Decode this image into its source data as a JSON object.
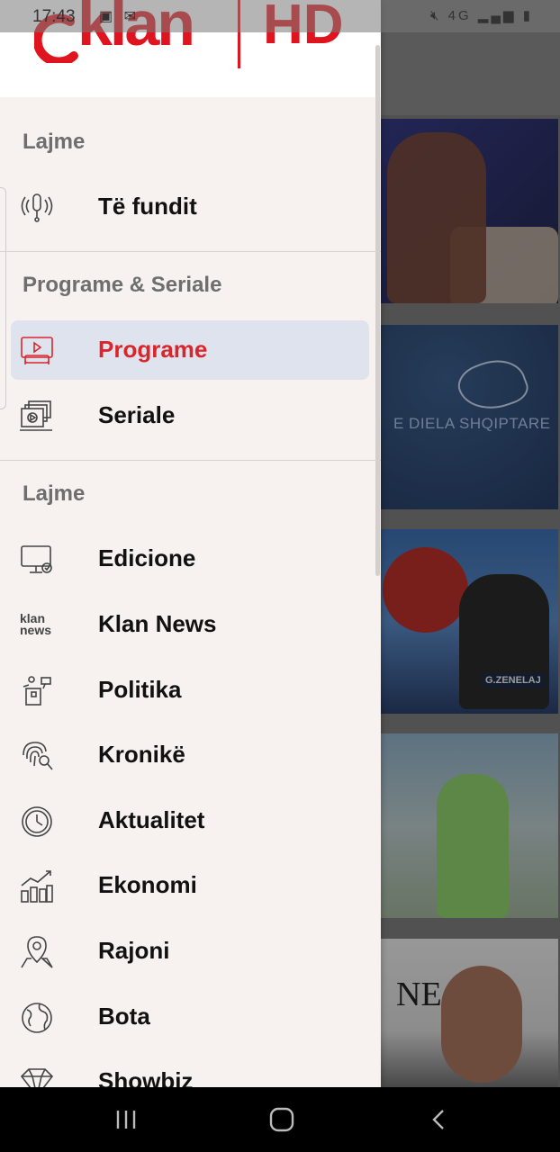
{
  "status_bar": {
    "time": "17:43",
    "left_icons": "✉",
    "right_text": "4G"
  },
  "drawer": {
    "logo": {
      "brand": "klan",
      "hd": "HD"
    },
    "sections": [
      {
        "title": "Lajme",
        "items": [
          {
            "label": "Të fundit",
            "icon": "broadcast-icon"
          }
        ]
      },
      {
        "title": "Programe & Seriale",
        "items": [
          {
            "label": "Programe",
            "icon": "tv-show-icon",
            "active": true
          },
          {
            "label": "Seriale",
            "icon": "episodes-icon"
          }
        ]
      },
      {
        "title": "Lajme",
        "items": [
          {
            "label": "Edicione",
            "icon": "monitor-icon"
          },
          {
            "label": "Klan News",
            "icon": "klan-news-icon",
            "icon_text_top": "klan",
            "icon_text_bottom": "news"
          },
          {
            "label": "Politika",
            "icon": "podium-icon"
          },
          {
            "label": "Kronikë",
            "icon": "fingerprint-icon"
          },
          {
            "label": "Aktualitet",
            "icon": "clock-icon"
          },
          {
            "label": "Ekonomi",
            "icon": "growth-chart-icon"
          },
          {
            "label": "Rajoni",
            "icon": "map-pin-icon"
          },
          {
            "label": "Bota",
            "icon": "globe-icon"
          },
          {
            "label": "Showbiz",
            "icon": "diamond-icon"
          }
        ]
      }
    ]
  },
  "background": {
    "cards": [
      {
        "caption": ""
      },
      {
        "caption": "E DIELA SHQIPTARE"
      },
      {
        "caption": "G.ZENELAJ"
      },
      {
        "caption": ""
      },
      {
        "caption": "NE"
      }
    ]
  },
  "colors": {
    "accent": "#d9262d",
    "drawer_bg": "#f7f2ef",
    "active_bg": "#dfe3ee"
  }
}
